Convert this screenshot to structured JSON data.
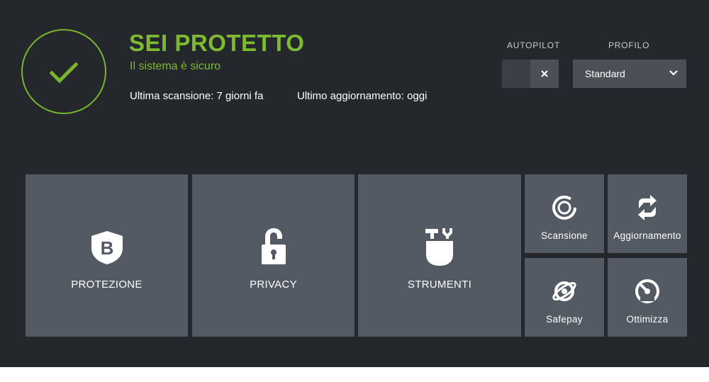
{
  "status": {
    "title": "SEI PROTETTO",
    "subtitle": "Il sistema è sicuro",
    "last_scan": "Ultima scansione: 7 giorni fa",
    "last_update": "Ultimo aggiornamento: oggi",
    "icon": "checkmark-icon",
    "accent_color": "#7dba2f"
  },
  "autopilot": {
    "label": "AUTOPILOT",
    "enabled": false,
    "icon": "close-icon"
  },
  "profile": {
    "label": "PROFILO",
    "value": "Standard",
    "icon": "chevron-down-icon"
  },
  "tiles": [
    {
      "label": "PROTEZIONE",
      "icon": "shield-icon"
    },
    {
      "label": "PRIVACY",
      "icon": "padlock-icon"
    },
    {
      "label": "STRUMENTI",
      "icon": "tools-icon"
    }
  ],
  "quick_actions": [
    {
      "label": "Scansione",
      "icon": "scan-icon"
    },
    {
      "label": "Aggiornamento",
      "icon": "update-icon"
    },
    {
      "label": "Safepay",
      "icon": "safepay-icon"
    },
    {
      "label": "Ottimizza",
      "icon": "optimize-icon"
    }
  ],
  "colors": {
    "background": "#24272b",
    "tile": "#535a63",
    "control": "#4b5057"
  }
}
